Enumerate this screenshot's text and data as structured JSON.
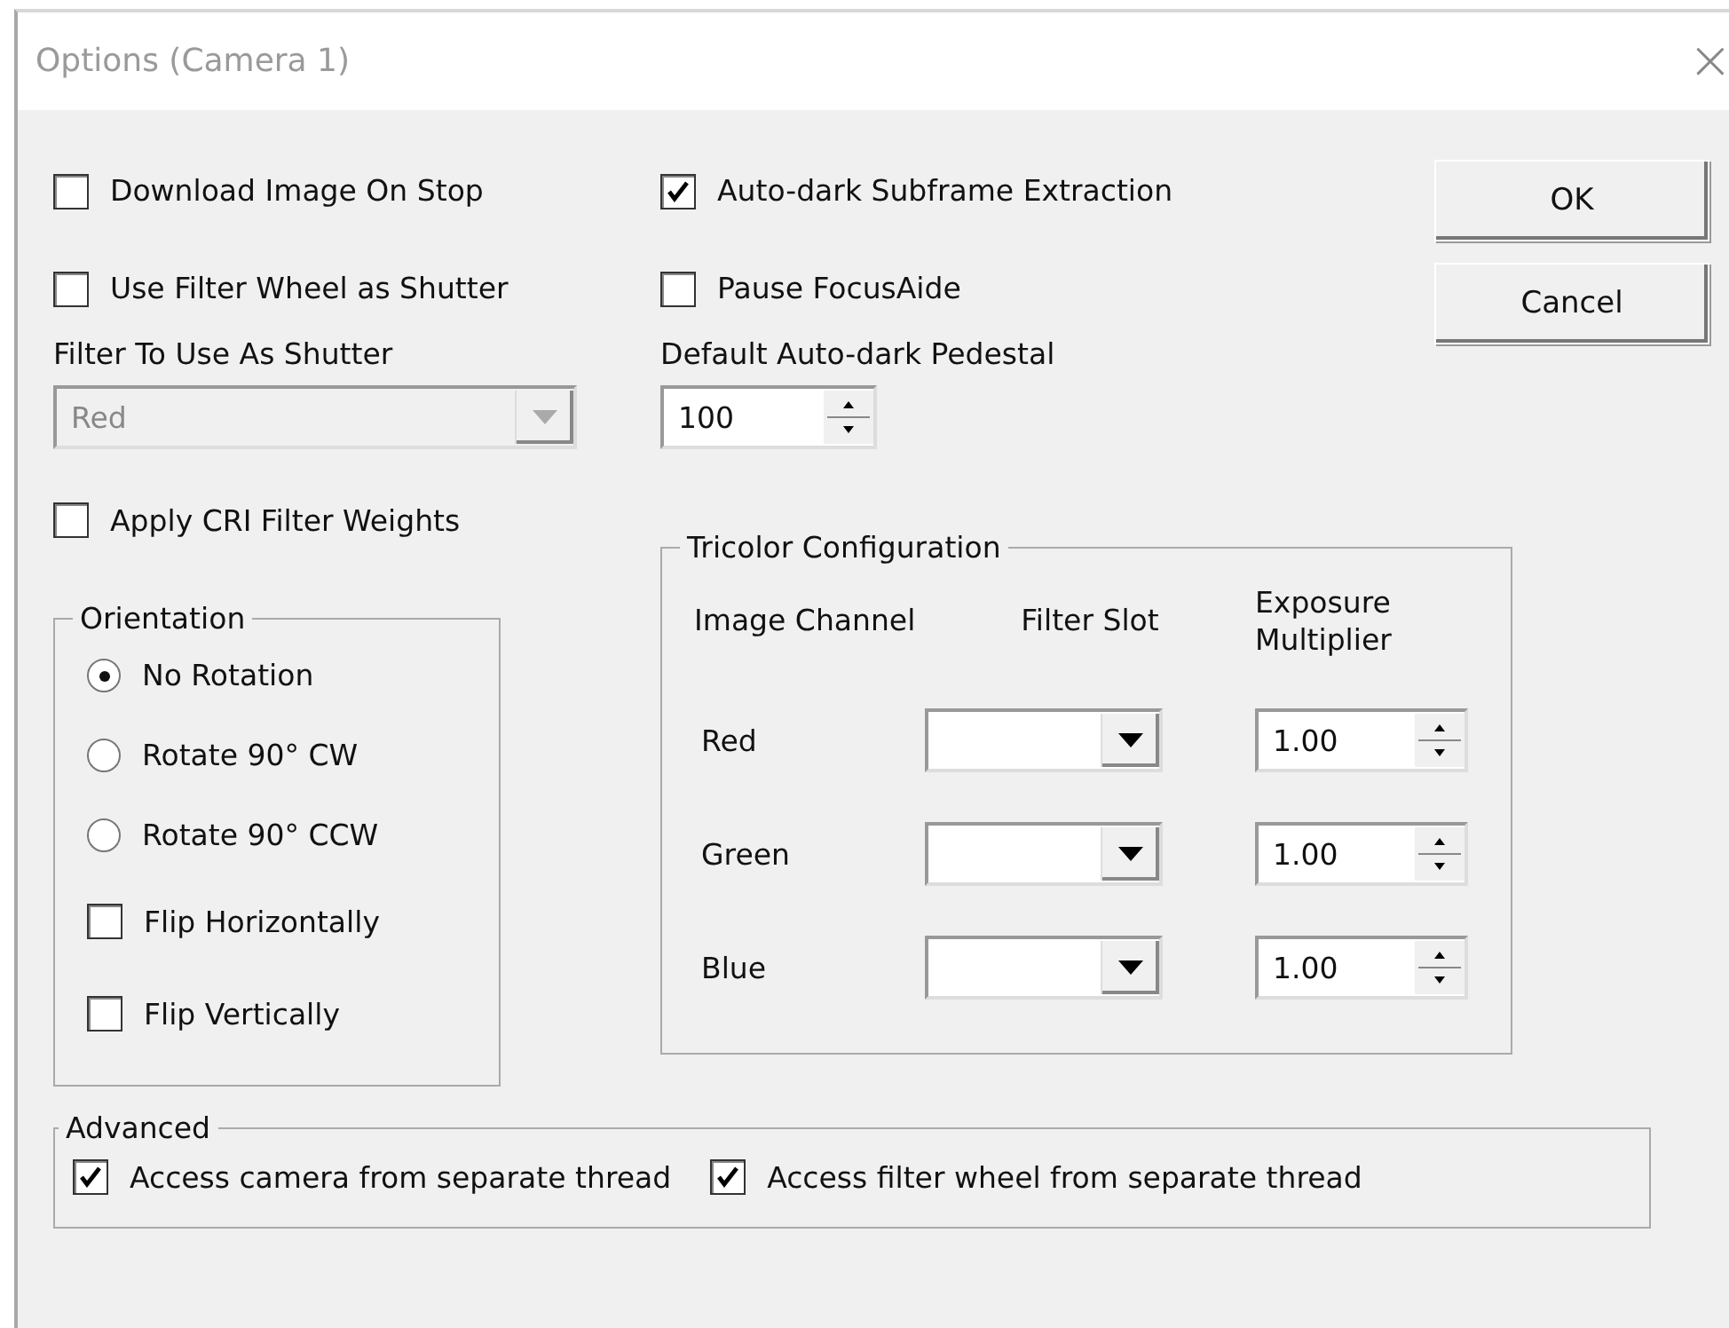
{
  "window": {
    "title": "Options (Camera 1)",
    "close": "×"
  },
  "left_options": [
    {
      "label": "Download Image On Stop",
      "checked": false
    },
    {
      "label": "Use Filter Wheel as Shutter",
      "checked": false
    }
  ],
  "shutter_filter": {
    "label": "Filter To Use As Shutter",
    "value": "Red",
    "disabled": true
  },
  "cri_option": {
    "label": "Apply CRI Filter Weights",
    "checked": false
  },
  "middle_options": [
    {
      "label": "Auto-dark Subframe Extraction",
      "checked": true
    },
    {
      "label": "Pause FocusAide",
      "checked": false
    }
  ],
  "pedestal": {
    "label": "Default Auto-dark Pedestal",
    "value": "100"
  },
  "buttons": [
    "OK",
    "Cancel"
  ],
  "orientation": {
    "title": "Orientation",
    "items": [
      {
        "kind": "radio",
        "label": "No Rotation",
        "selected": true
      },
      {
        "kind": "radio",
        "label": "Rotate 90° CW",
        "selected": false
      },
      {
        "kind": "radio",
        "label": "Rotate 90° CCW",
        "selected": false
      },
      {
        "kind": "checkbox",
        "label": "Flip Horizontally",
        "checked": false
      },
      {
        "kind": "checkbox",
        "label": "Flip Vertically",
        "checked": false
      }
    ]
  },
  "tricolor": {
    "title": "Tricolor Configuration",
    "columns": [
      "Image Channel",
      "Filter Slot",
      "Exposure Multiplier"
    ],
    "rows": [
      {
        "channel": "Red",
        "multiplier": "1.00"
      },
      {
        "channel": "Green",
        "multiplier": "1.00"
      },
      {
        "channel": "Blue",
        "multiplier": "1.00"
      }
    ]
  },
  "advanced": {
    "title": "Advanced",
    "items": [
      {
        "label": "Access camera from separate thread",
        "checked": true
      },
      {
        "label": "Access filter wheel from separate thread",
        "checked": true
      }
    ]
  }
}
